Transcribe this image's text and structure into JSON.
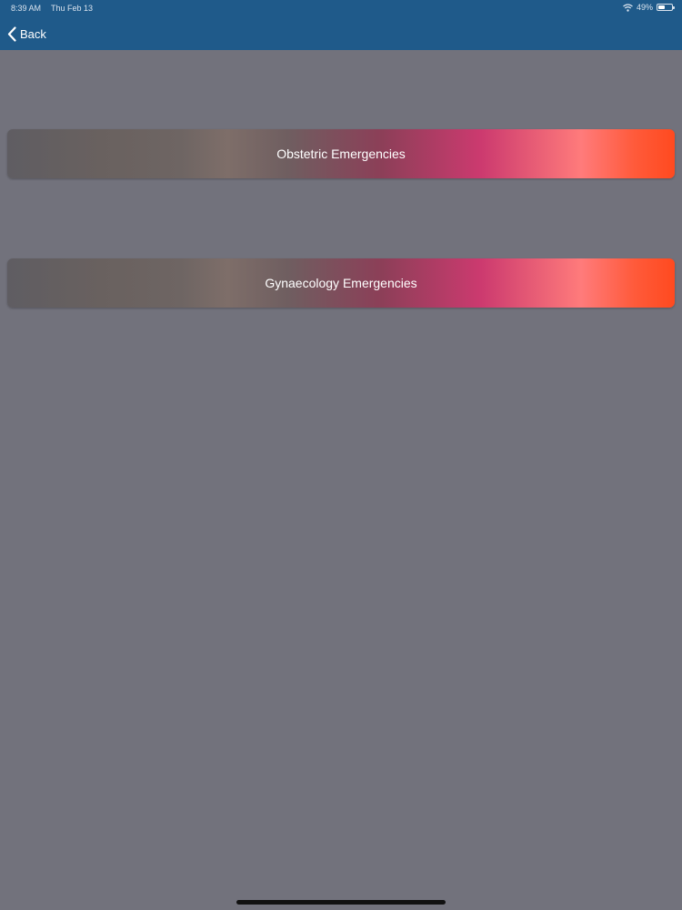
{
  "status_bar": {
    "time": "8:39 AM",
    "date": "Thu Feb 13",
    "battery": "49%",
    "wifi_icon": "wifi-icon",
    "battery_icon": "battery-icon"
  },
  "nav": {
    "back_label": "Back",
    "back_icon": "chevron-left-icon",
    "bar_color": "#1f5a8a"
  },
  "menu": {
    "items": [
      {
        "label": "Obstetric Emergencies"
      },
      {
        "label": "Gynaecology Emergencies"
      }
    ]
  },
  "colors": {
    "background": "#72727c",
    "accent_start": "#5f5d62",
    "accent_end": "#ff4a1f"
  }
}
